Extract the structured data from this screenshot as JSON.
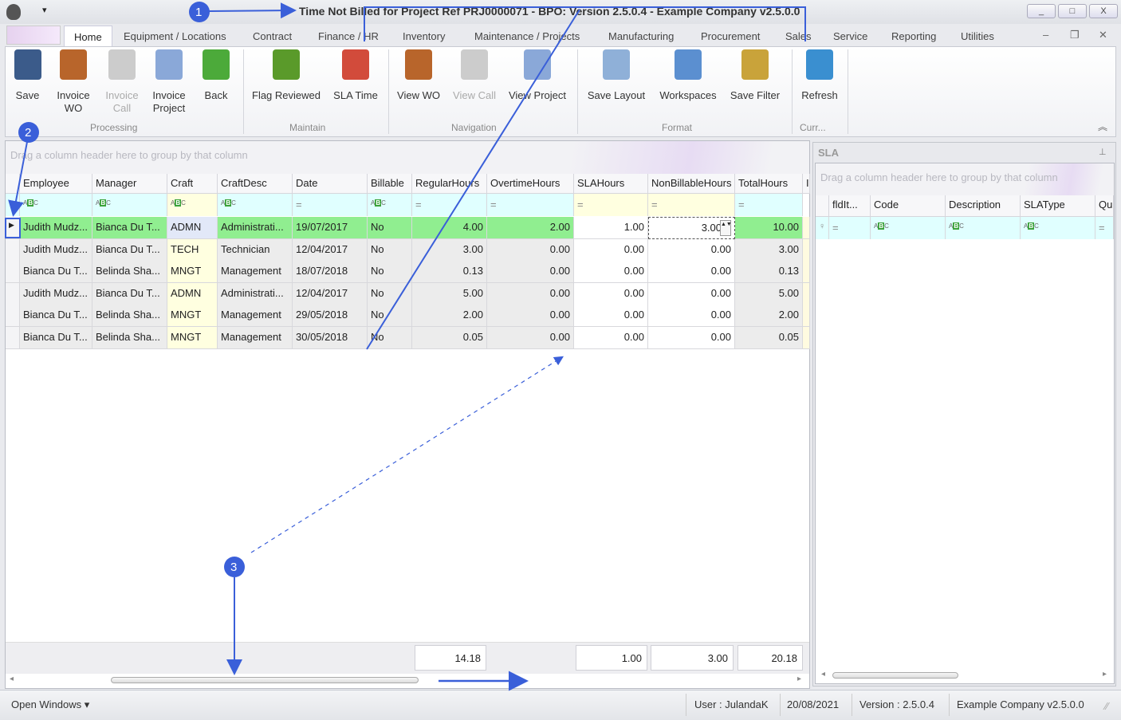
{
  "window": {
    "title": "Time Not Billed for Project Ref PRJ0000071 - BPO: Version 2.5.0.4 - Example Company v2.5.0.0",
    "minimize": "_",
    "maximize": "□",
    "close": "X"
  },
  "menu_tabs": [
    "Home",
    "Equipment / Locations",
    "Contract",
    "Finance / HR",
    "Inventory",
    "Maintenance / Projects",
    "Manufacturing",
    "Procurement",
    "Sales",
    "Service",
    "Reporting",
    "Utilities"
  ],
  "ribbon": {
    "buttons": [
      {
        "label": "Save",
        "icon": "save-icon",
        "enabled": true
      },
      {
        "label": "Invoice\nWO",
        "icon": "invoice-wo-icon",
        "enabled": true
      },
      {
        "label": "Invoice\nCall",
        "icon": "invoice-call-icon",
        "enabled": false
      },
      {
        "label": "Invoice\nProject",
        "icon": "invoice-project-icon",
        "enabled": true
      },
      {
        "label": "Back",
        "icon": "back-arrow-icon",
        "enabled": true
      },
      {
        "label": "Flag Reviewed",
        "icon": "flag-icon",
        "enabled": true
      },
      {
        "label": "SLA Time",
        "icon": "calendar-clock-icon",
        "enabled": true
      },
      {
        "label": "View WO",
        "icon": "view-wo-icon",
        "enabled": true
      },
      {
        "label": "View Call",
        "icon": "view-call-icon",
        "enabled": false
      },
      {
        "label": "View Project",
        "icon": "view-project-icon",
        "enabled": true
      },
      {
        "label": "Save Layout",
        "icon": "save-layout-icon",
        "enabled": true
      },
      {
        "label": "Workspaces",
        "icon": "workspaces-icon",
        "enabled": true
      },
      {
        "label": "Save Filter",
        "icon": "save-filter-icon",
        "enabled": true
      },
      {
        "label": "Refresh",
        "icon": "refresh-icon",
        "enabled": true
      }
    ],
    "groups": [
      "Processing",
      "Maintain",
      "Navigation",
      "Format",
      "Curr..."
    ]
  },
  "main_grid": {
    "group_hint": "Drag a column header here to group by that column",
    "columns": [
      "Employee",
      "Manager",
      "Craft",
      "CraftDesc",
      "Date",
      "Billable",
      "RegularHours",
      "OvertimeHours",
      "SLAHours",
      "NonBillableHours",
      "TotalHours",
      "I"
    ],
    "filters": [
      "abc",
      "abc",
      "abc",
      "abc",
      "=",
      "abc",
      "=",
      "=",
      "=",
      "=",
      "="
    ],
    "rows": [
      [
        "Judith Mudz...",
        "Bianca Du T...",
        "ADMN",
        "Administrati...",
        "19/07/2017",
        "No",
        "4.00",
        "2.00",
        "1.00",
        "3.00",
        "10.00"
      ],
      [
        "Judith Mudz...",
        "Bianca Du T...",
        "TECH",
        "Technician",
        "12/04/2017",
        "No",
        "3.00",
        "0.00",
        "0.00",
        "0.00",
        "3.00"
      ],
      [
        "Bianca Du T...",
        "Belinda Sha...",
        "MNGT",
        "Management",
        "18/07/2018",
        "No",
        "0.13",
        "0.00",
        "0.00",
        "0.00",
        "0.13"
      ],
      [
        "Judith Mudz...",
        "Bianca Du T...",
        "ADMN",
        "Administrati...",
        "12/04/2017",
        "No",
        "5.00",
        "0.00",
        "0.00",
        "0.00",
        "5.00"
      ],
      [
        "Bianca Du T...",
        "Belinda Sha...",
        "MNGT",
        "Management",
        "29/05/2018",
        "No",
        "2.00",
        "0.00",
        "0.00",
        "0.00",
        "2.00"
      ],
      [
        "Bianca Du T...",
        "Belinda Sha...",
        "MNGT",
        "Management",
        "30/05/2018",
        "No",
        "0.05",
        "0.00",
        "0.00",
        "0.00",
        "0.05"
      ]
    ],
    "totals": {
      "RegularHours": "14.18",
      "SLAHours": "1.00",
      "NonBillableHours": "3.00",
      "TotalHours": "20.18"
    },
    "selected_row": 0,
    "colors": {
      "selected": "#90ee90",
      "readonly": "#ececec",
      "editable": "#ffffff",
      "craft": "#ffffe0",
      "filter": "#e0ffff"
    }
  },
  "sla_panel": {
    "title": "SLA",
    "group_hint": "Drag a column header here to group by that column",
    "columns": [
      "fldIt...",
      "Code",
      "Description",
      "SLAType",
      "Qu"
    ],
    "filters": [
      "=",
      "abc",
      "abc",
      "abc",
      "="
    ]
  },
  "status_bar": {
    "open_windows": "Open Windows ▾",
    "user": "User : JulandaK",
    "date": "20/08/2021",
    "version": "Version : 2.5.0.4",
    "company": "Example Company v2.5.0.0"
  },
  "annotations": [
    "1",
    "2",
    "3"
  ],
  "accent": "#3a5fd9"
}
